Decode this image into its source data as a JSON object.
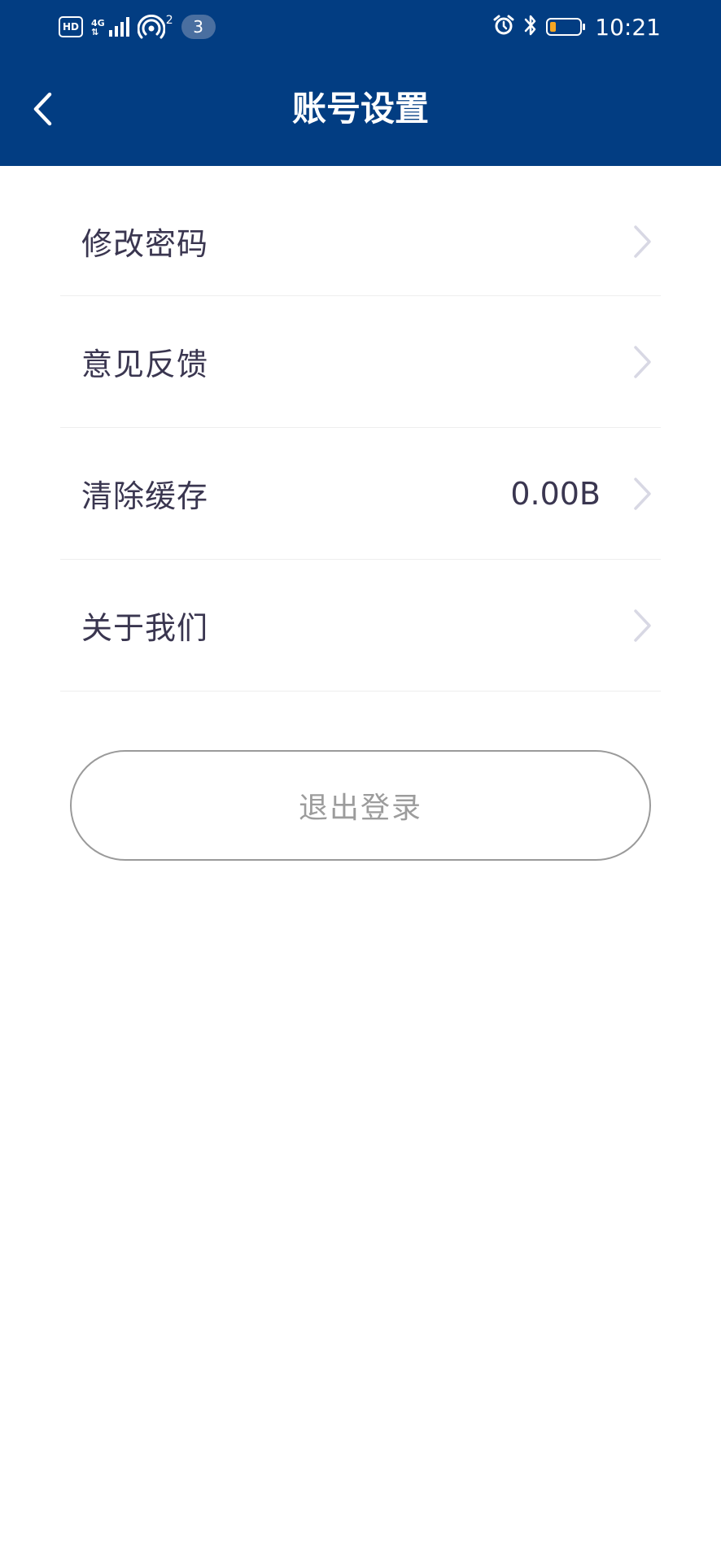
{
  "status_bar": {
    "hd_label": "HD",
    "network_type": "4G",
    "hotspot_count": "2",
    "notification_count": "3",
    "battery_level": 0.2,
    "time": "10:21",
    "icons": [
      "hd-icon",
      "signal-icon",
      "hotspot-icon",
      "alarm-icon",
      "bluetooth-icon",
      "battery-icon"
    ]
  },
  "header": {
    "title": "账号设置",
    "back_icon": "chevron-left-icon",
    "background": "#023d82"
  },
  "menu": {
    "items": [
      {
        "label": "修改密码",
        "value": "",
        "icon": "chevron-right-icon"
      },
      {
        "label": "意见反馈",
        "value": "",
        "icon": "chevron-right-icon"
      },
      {
        "label": "清除缓存",
        "value": "0.00B",
        "icon": "chevron-right-icon"
      },
      {
        "label": "关于我们",
        "value": "",
        "icon": "chevron-right-icon"
      }
    ]
  },
  "logout": {
    "label": "退出登录"
  }
}
